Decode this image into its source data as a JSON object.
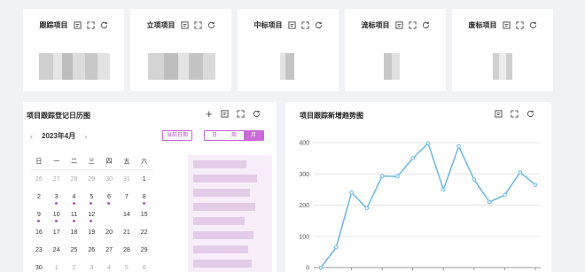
{
  "stats": [
    {
      "title": "跟踪项目"
    },
    {
      "title": "立项项目"
    },
    {
      "title": "中标项目"
    },
    {
      "title": "流标项目"
    },
    {
      "title": "废标项目"
    }
  ],
  "calendar": {
    "title": "项目跟踪登记日历图",
    "month_label": "2023年4月",
    "prev": "‹",
    "next": "›",
    "today_button": "当前日期",
    "views": [
      "日",
      "周",
      "月"
    ],
    "active_view": "月",
    "weekdays": [
      "日",
      "一",
      "二",
      "三",
      "四",
      "五",
      "六"
    ],
    "rows": [
      [
        "26",
        "27",
        "28",
        "29",
        "30",
        "31",
        "1"
      ],
      [
        "2",
        "3",
        "4",
        "5",
        "6",
        "7",
        "8"
      ],
      [
        "9",
        "10",
        "11",
        "12",
        "13",
        "14",
        "15"
      ],
      [
        "16",
        "17",
        "18",
        "19",
        "20",
        "21",
        "22"
      ],
      [
        "23",
        "24",
        "25",
        "26",
        "27",
        "28",
        "29"
      ],
      [
        "30",
        "1",
        "2",
        "3",
        "4",
        "5",
        "6"
      ]
    ],
    "today": "13",
    "accent": "#c86bd6"
  },
  "trend": {
    "title": "项目跟踪新增趋势图",
    "line_color": "#6ab7e6"
  },
  "chart_data": {
    "type": "line",
    "title": "项目跟踪新增趋势图",
    "xlabel": "",
    "ylabel": "",
    "ylim": [
      0,
      400
    ],
    "yticks": [
      "0",
      "100",
      "200",
      "300",
      "400"
    ],
    "grid": true,
    "series": [
      {
        "values": [
          0,
          65,
          240,
          190,
          293,
          292,
          350,
          398,
          250,
          388,
          282,
          210,
          232,
          305,
          265
        ]
      }
    ]
  }
}
